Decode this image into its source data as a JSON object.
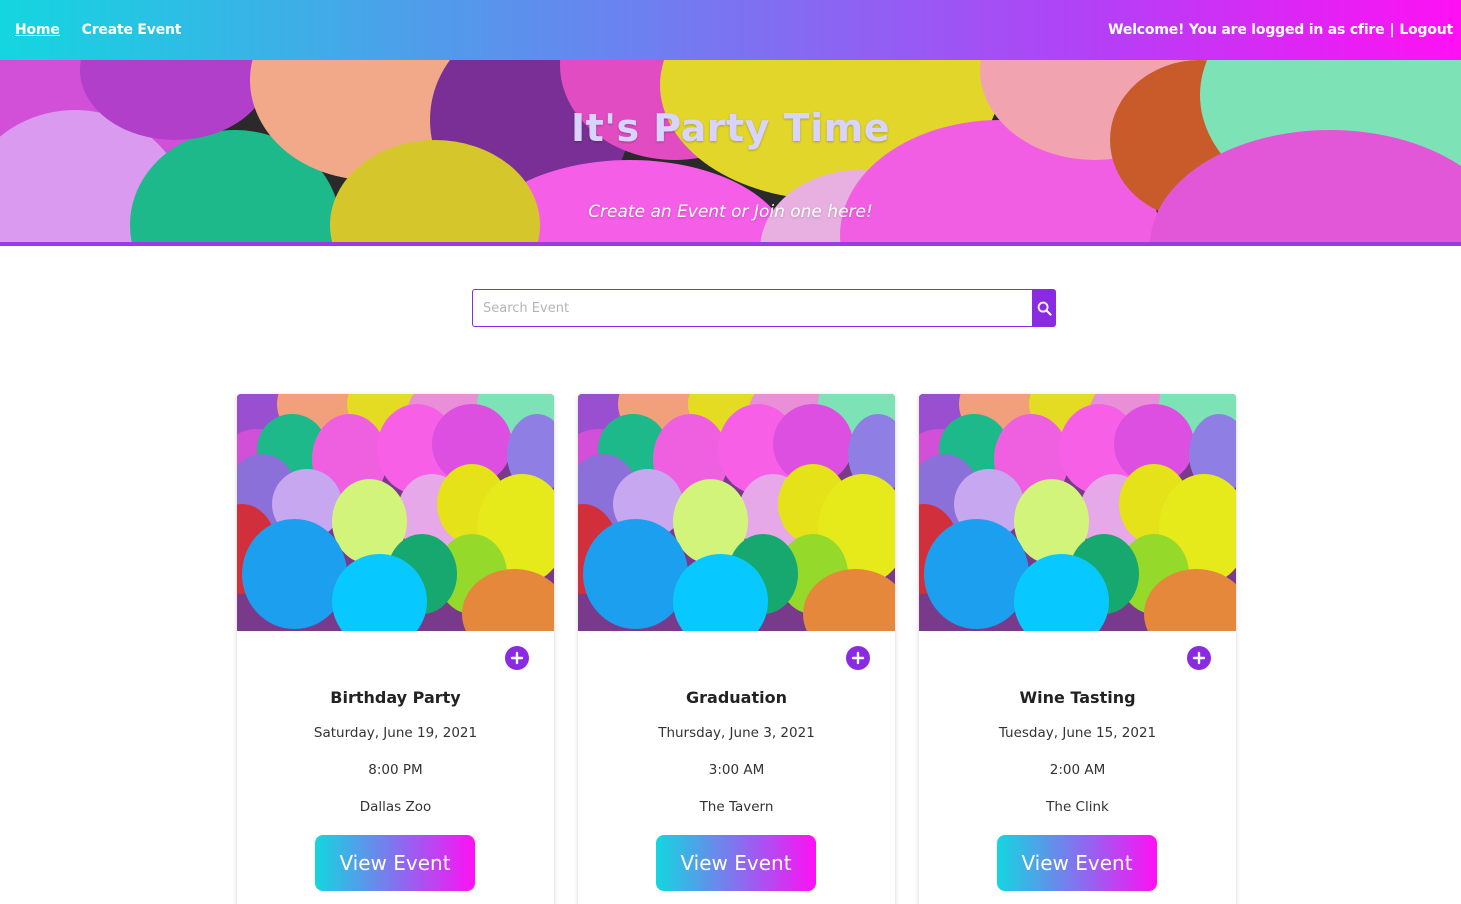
{
  "nav": {
    "home_label": "Home",
    "create_label": "Create Event",
    "welcome_text": "Welcome! You are logged in as cfire",
    "separator": "|",
    "logout_label": "Logout"
  },
  "hero": {
    "title": "It's Party Time",
    "subtitle": "Create an Event or Join one here!"
  },
  "search": {
    "placeholder": "Search Event",
    "value": "",
    "button_icon": "search-icon"
  },
  "events": [
    {
      "title": "Birthday Party",
      "date": "Saturday, June 19, 2021",
      "time": "8:00 PM",
      "location": "Dallas Zoo",
      "button_label": "View Event",
      "add_icon": "plus-circle-icon"
    },
    {
      "title": "Graduation",
      "date": "Thursday, June 3, 2021",
      "time": "3:00 AM",
      "location": "The Tavern",
      "button_label": "View Event",
      "add_icon": "plus-circle-icon"
    },
    {
      "title": "Wine Tasting",
      "date": "Tuesday, June 15, 2021",
      "time": "2:00 AM",
      "location": "The Clink",
      "button_label": "View Event",
      "add_icon": "plus-circle-icon"
    }
  ],
  "colors": {
    "accent": "#8a2be2",
    "gradient_start": "#14d6e0",
    "gradient_end": "#ff10f4"
  }
}
